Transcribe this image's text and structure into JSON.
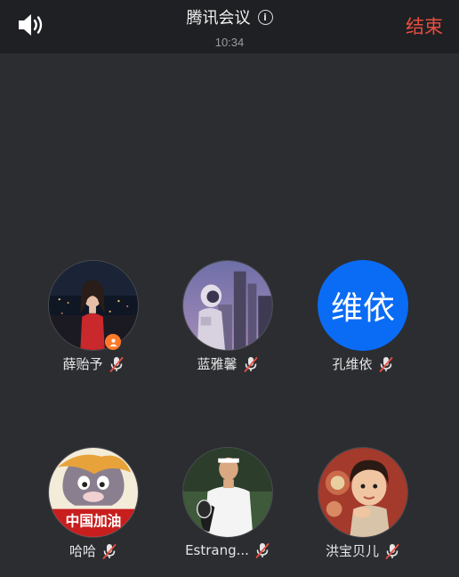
{
  "header": {
    "speaker_icon": "speaker-icon",
    "title": "腾讯会议",
    "info_icon": "info-icon",
    "info_glyph": "i",
    "timer": "10:34",
    "end_label": "结束",
    "end_color": "#e84e40"
  },
  "participants": [
    {
      "name": "薛贻予",
      "avatar": "photo-woman-city-night",
      "host": true,
      "muted": true
    },
    {
      "name": "蓝雅馨",
      "avatar": "photo-astronaut-buildings",
      "host": false,
      "muted": true
    },
    {
      "name": "孔维依",
      "avatar_text": "维依",
      "avatar_color": "#0a6cf5",
      "host": false,
      "muted": true
    },
    {
      "name": "哈哈",
      "avatar": "photo-cartoon-cat-banner",
      "avatar_banner_text": "中国加油",
      "host": false,
      "muted": true
    },
    {
      "name": "Estrang...",
      "avatar": "photo-tennis-player",
      "host": false,
      "muted": true
    },
    {
      "name": "洪宝贝儿",
      "avatar": "photo-child-portrait",
      "host": false,
      "muted": true
    }
  ],
  "colors": {
    "background": "#2b2d31",
    "topbar": "#1f2023",
    "host_badge": "#ff7a2a",
    "mute_slash": "#e84e40"
  }
}
